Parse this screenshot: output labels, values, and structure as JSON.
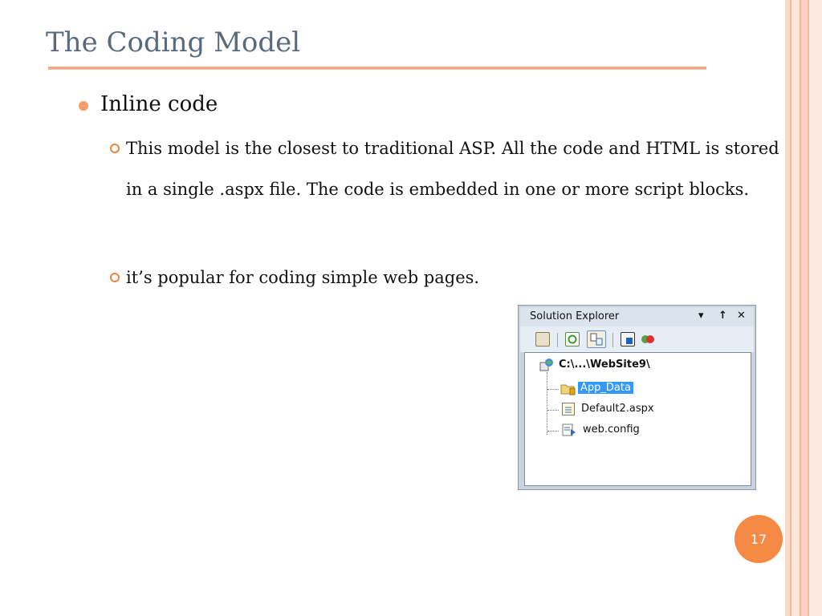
{
  "slide": {
    "title": "The Coding Model",
    "bullet": "Inline code",
    "sub_bullets": [
      "This model is the closest to traditional ASP. All the code and HTML is stored in a single .aspx file. The code is embedded in one or more script blocks.",
      "it’s popular for coding simple web pages."
    ],
    "page_number": "17"
  },
  "solution_explorer": {
    "title": "Solution Explorer",
    "controls": {
      "dropdown": "▾",
      "pin": "↑",
      "close": "✕"
    },
    "toolbar_icons": [
      "properties-icon",
      "refresh-icon",
      "nest-related-files-icon",
      "view-code-icon",
      "copy-website-icon"
    ],
    "root": "C:\\...\\WebSite9\\",
    "items": [
      {
        "label": "App_Data",
        "icon": "folder-icon",
        "selected": true
      },
      {
        "label": "Default2.aspx",
        "icon": "aspx-file-icon",
        "selected": false
      },
      {
        "label": "web.config",
        "icon": "config-file-icon",
        "selected": false
      }
    ]
  },
  "colors": {
    "title": "#5a6a7c",
    "accent": "#f58a44",
    "selection": "#3399ff"
  }
}
